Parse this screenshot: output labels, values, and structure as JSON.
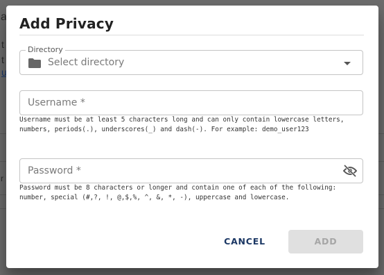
{
  "background": {
    "fragments": [
      "a",
      "t",
      "t"
    ],
    "link_fragment": "u",
    "fragment_r": "r"
  },
  "dialog": {
    "title": "Add Privacy",
    "directory": {
      "label": "Directory",
      "placeholder": "Select directory",
      "icon": "folder-icon"
    },
    "username": {
      "placeholder": "Username *",
      "helper": "Username must be at least 5 characters long and can only contain lowercase letters, numbers, periods(.), underscores(_) and dash(-). For example: demo_user123"
    },
    "password": {
      "placeholder": "Password *",
      "icon": "eye-off-icon",
      "helper": "Password must be 8 characters or longer and contain one of each of the following: number, special (#,?, !, @,$,%, ^, &, *, -), uppercase and lowercase."
    },
    "buttons": {
      "cancel": "CANCEL",
      "add": "ADD"
    }
  },
  "colors": {
    "primary": "#1b3764",
    "disabled_bg": "#e0e0e0",
    "disabled_text": "#a6a6a6"
  }
}
